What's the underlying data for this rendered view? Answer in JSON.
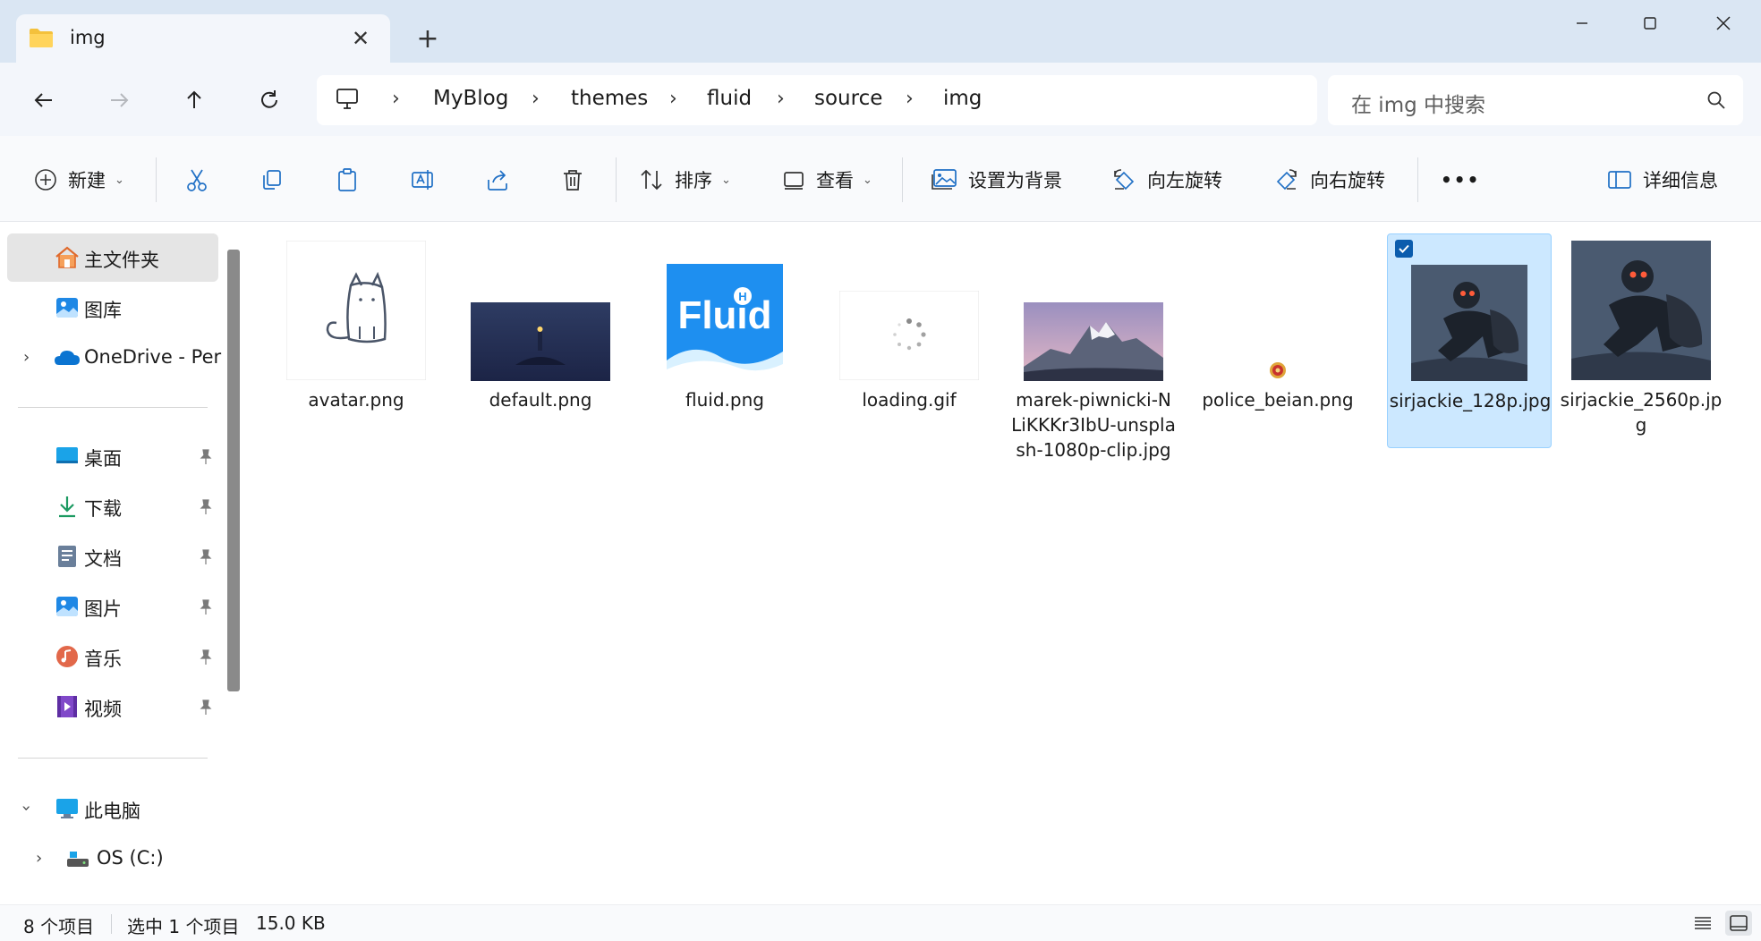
{
  "tab": {
    "title": "img",
    "close_icon": "close-icon",
    "new_tab_icon": "plus-icon"
  },
  "window": {
    "minimize": "minimize-icon",
    "maximize": "maximize-icon",
    "close": "close-icon"
  },
  "nav": {
    "breadcrumb": [
      "MyBlog",
      "themes",
      "fluid",
      "source",
      "img"
    ],
    "search_placeholder": "在 img 中搜索"
  },
  "toolbar": {
    "new": "新建",
    "sort": "排序",
    "view": "查看",
    "set_background": "设置为背景",
    "rotate_left": "向左旋转",
    "rotate_right": "向右旋转",
    "more": "•••",
    "details": "详细信息"
  },
  "sidebar": {
    "home": "主文件夹",
    "gallery": "图库",
    "onedrive": "OneDrive - Per",
    "quick_access": [
      "桌面",
      "下载",
      "文档",
      "图片",
      "音乐",
      "视频"
    ],
    "this_pc": "此电脑",
    "drive_c": "OS (C:)"
  },
  "files": [
    {
      "name": "avatar.png",
      "thumb": "cat-sketch"
    },
    {
      "name": "default.png",
      "thumb": "night-lighthouse"
    },
    {
      "name": "fluid.png",
      "thumb": "fluid-logo"
    },
    {
      "name": "loading.gif",
      "thumb": "spinner"
    },
    {
      "name": "marek-piwnicki-NLiKKKr3IbU-unsplash-1080p-clip.jpg",
      "thumb": "mountain"
    },
    {
      "name": "police_beian.png",
      "thumb": "police-badge"
    },
    {
      "name": "sirjackie_128p.jpg",
      "thumb": "soldier",
      "selected": true
    },
    {
      "name": "sirjackie_2560p.jpg",
      "thumb": "soldier"
    }
  ],
  "fluid_logo_text": "Fluid",
  "fluid_logo_badge": "H",
  "status": {
    "count": "8 个项目",
    "selection": "选中 1 个项目",
    "size": "15.0 KB"
  },
  "colors": {
    "accent": "#0b5cad",
    "titlebar": "#dae6f3",
    "selection": "#cce8ff",
    "fluid_blue": "#1e8ff0"
  }
}
